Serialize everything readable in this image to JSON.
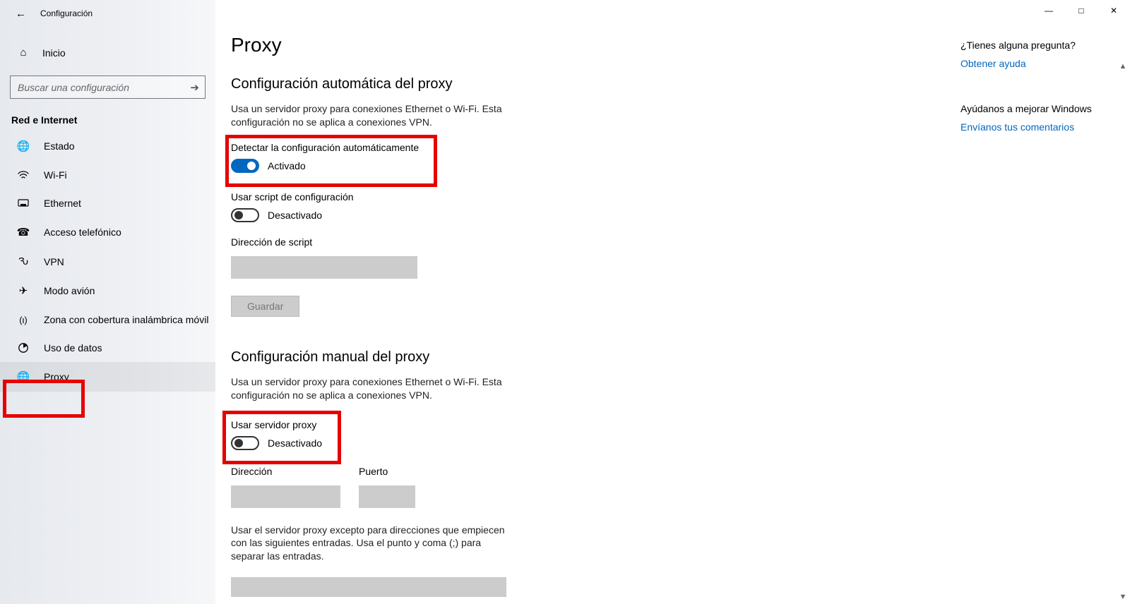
{
  "window": {
    "title": "Configuración"
  },
  "sidebar": {
    "home_label": "Inicio",
    "search_placeholder": "Buscar una configuración",
    "section_label": "Red e Internet",
    "items": [
      {
        "icon": "status-icon",
        "label": "Estado"
      },
      {
        "icon": "wifi-icon",
        "label": "Wi-Fi"
      },
      {
        "icon": "ethernet-icon",
        "label": "Ethernet"
      },
      {
        "icon": "dialup-icon",
        "label": "Acceso telefónico"
      },
      {
        "icon": "vpn-icon",
        "label": "VPN"
      },
      {
        "icon": "airplane-icon",
        "label": "Modo avión"
      },
      {
        "icon": "hotspot-icon",
        "label": "Zona con cobertura inalámbrica móvil"
      },
      {
        "icon": "datausage-icon",
        "label": "Uso de datos"
      },
      {
        "icon": "proxy-icon",
        "label": "Proxy",
        "selected": true
      }
    ]
  },
  "main": {
    "page_title": "Proxy",
    "auto": {
      "section_title": "Configuración automática del proxy",
      "desc": "Usa un servidor proxy para conexiones Ethernet o Wi-Fi. Esta configuración no se aplica a conexiones VPN.",
      "detect_label": "Detectar la configuración automáticamente",
      "detect_state": "Activado",
      "script_label": "Usar script de configuración",
      "script_state": "Desactivado",
      "script_addr_label": "Dirección de script",
      "save_label": "Guardar"
    },
    "manual": {
      "section_title": "Configuración manual del proxy",
      "desc": "Usa un servidor proxy para conexiones Ethernet o Wi-Fi. Esta configuración no se aplica a conexiones VPN.",
      "use_label": "Usar servidor proxy",
      "use_state": "Desactivado",
      "address_label": "Dirección",
      "port_label": "Puerto",
      "exceptions_desc": "Usar el servidor proxy excepto para direcciones que empiecen con las siguientes entradas. Usa el punto y coma (;) para separar las entradas."
    }
  },
  "help": {
    "q_heading": "¿Tienes alguna pregunta?",
    "q_link": "Obtener ayuda",
    "fb_heading": "Ayúdanos a mejorar Windows",
    "fb_link": "Envíanos tus comentarios"
  }
}
